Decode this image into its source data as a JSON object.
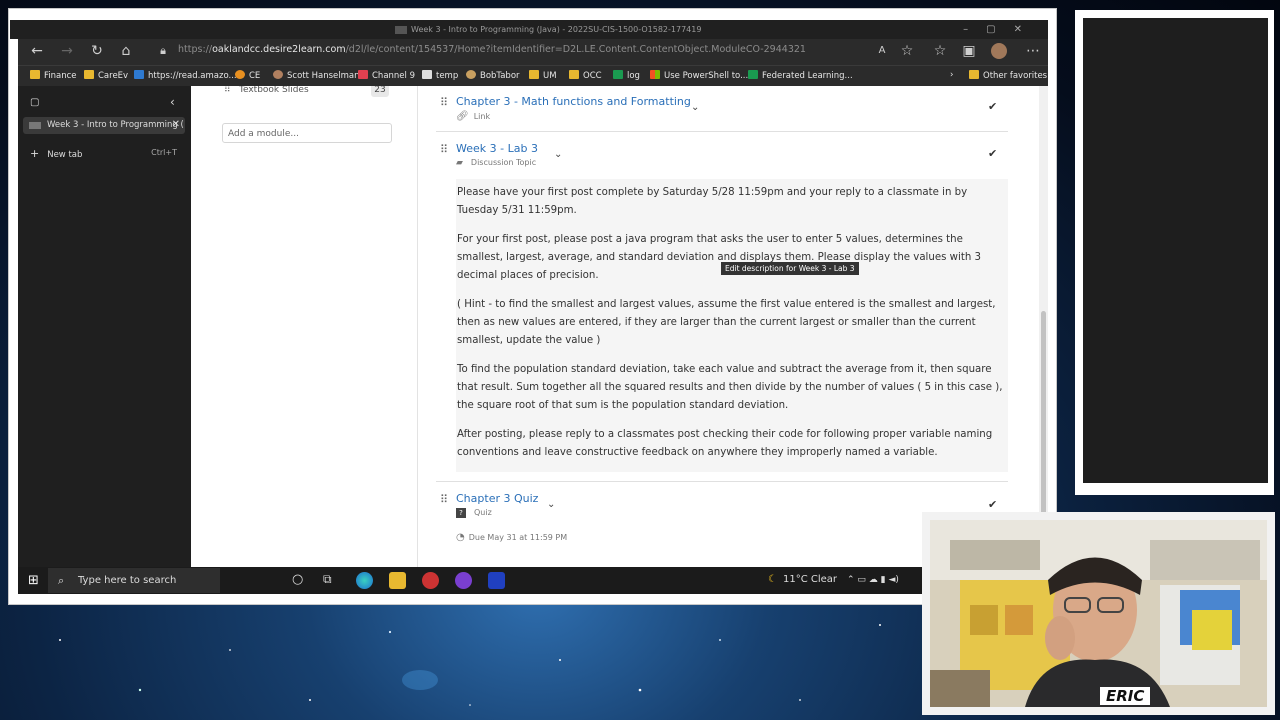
{
  "browser": {
    "window_title": "Week 3 - Intro to Programming (Java) - 2022SU-CIS-1500-O1582-177419",
    "url_prefix": "https://",
    "url_domain": "oaklandcc.desire2learn.com",
    "url_path": "/d2l/le/content/154537/Home?itemIdentifier=D2L.LE.Content.ContentObject.ModuleCO-2944321",
    "bookmarks": [
      "Finance",
      "CareEv",
      "https://read.amazo...",
      "CE",
      "Scott Hanselman",
      "Channel 9",
      "temp",
      "BobTabor",
      "UM",
      "OCC",
      "log",
      "Use PowerShell to...",
      "Federated Learning..."
    ],
    "other_favorites": "Other favorites"
  },
  "sidebar": {
    "active_tab": "Week 3 - Intro to Programming (",
    "new_tab": "New tab",
    "new_tab_shortcut": "Ctrl+T"
  },
  "left_pane": {
    "textbook_label": "Textbook Slides",
    "textbook_count": "23",
    "add_module": "Add a module..."
  },
  "items": [
    {
      "title": "Chapter 3 - Math functions and Formatting",
      "type": "Link"
    },
    {
      "title": "Week 3 - Lab 3",
      "type": "Discussion Topic"
    },
    {
      "title": "Chapter 3 Quiz",
      "type": "Quiz",
      "due": "Due May 31 at 11:59 PM"
    }
  ],
  "description": {
    "p1": "Please have your first post complete by Saturday 5/28 11:59pm and your reply to a classmate in by Tuesday 5/31 11:59pm.",
    "p2": "For your first post, please post a java program that asks the user to enter 5 values, determines the smallest, largest, average, and standard deviation and displays them.  Please display the values with 3 decimal places of precision.",
    "p3": "( Hint - to find the smallest and largest values, assume the first value entered is the smallest and largest, then as new values are entered, if they are larger than the current largest or smaller than the current smallest, update the value )",
    "p4": "To find the population standard deviation, take each value and subtract the average from it, then square that result.  Sum together all the squared results and then divide by the number of values ( 5 in this case ), the square root of that sum is the population standard deviation.",
    "p5": "After posting, please reply to a classmates post checking their code for following proper variable naming conventions and leave constructive feedback on anywhere they improperly named a variable."
  },
  "tooltip": "Edit description for Week 3 - Lab 3",
  "taskbar": {
    "search_placeholder": "Type here to search",
    "weather": "11°C  Clear"
  },
  "webcam": {
    "label": "ERIC"
  },
  "colors": {
    "link": "#2a6fb8",
    "chrome_dark": "#2b2b2b",
    "desktop": "#0c2444"
  }
}
